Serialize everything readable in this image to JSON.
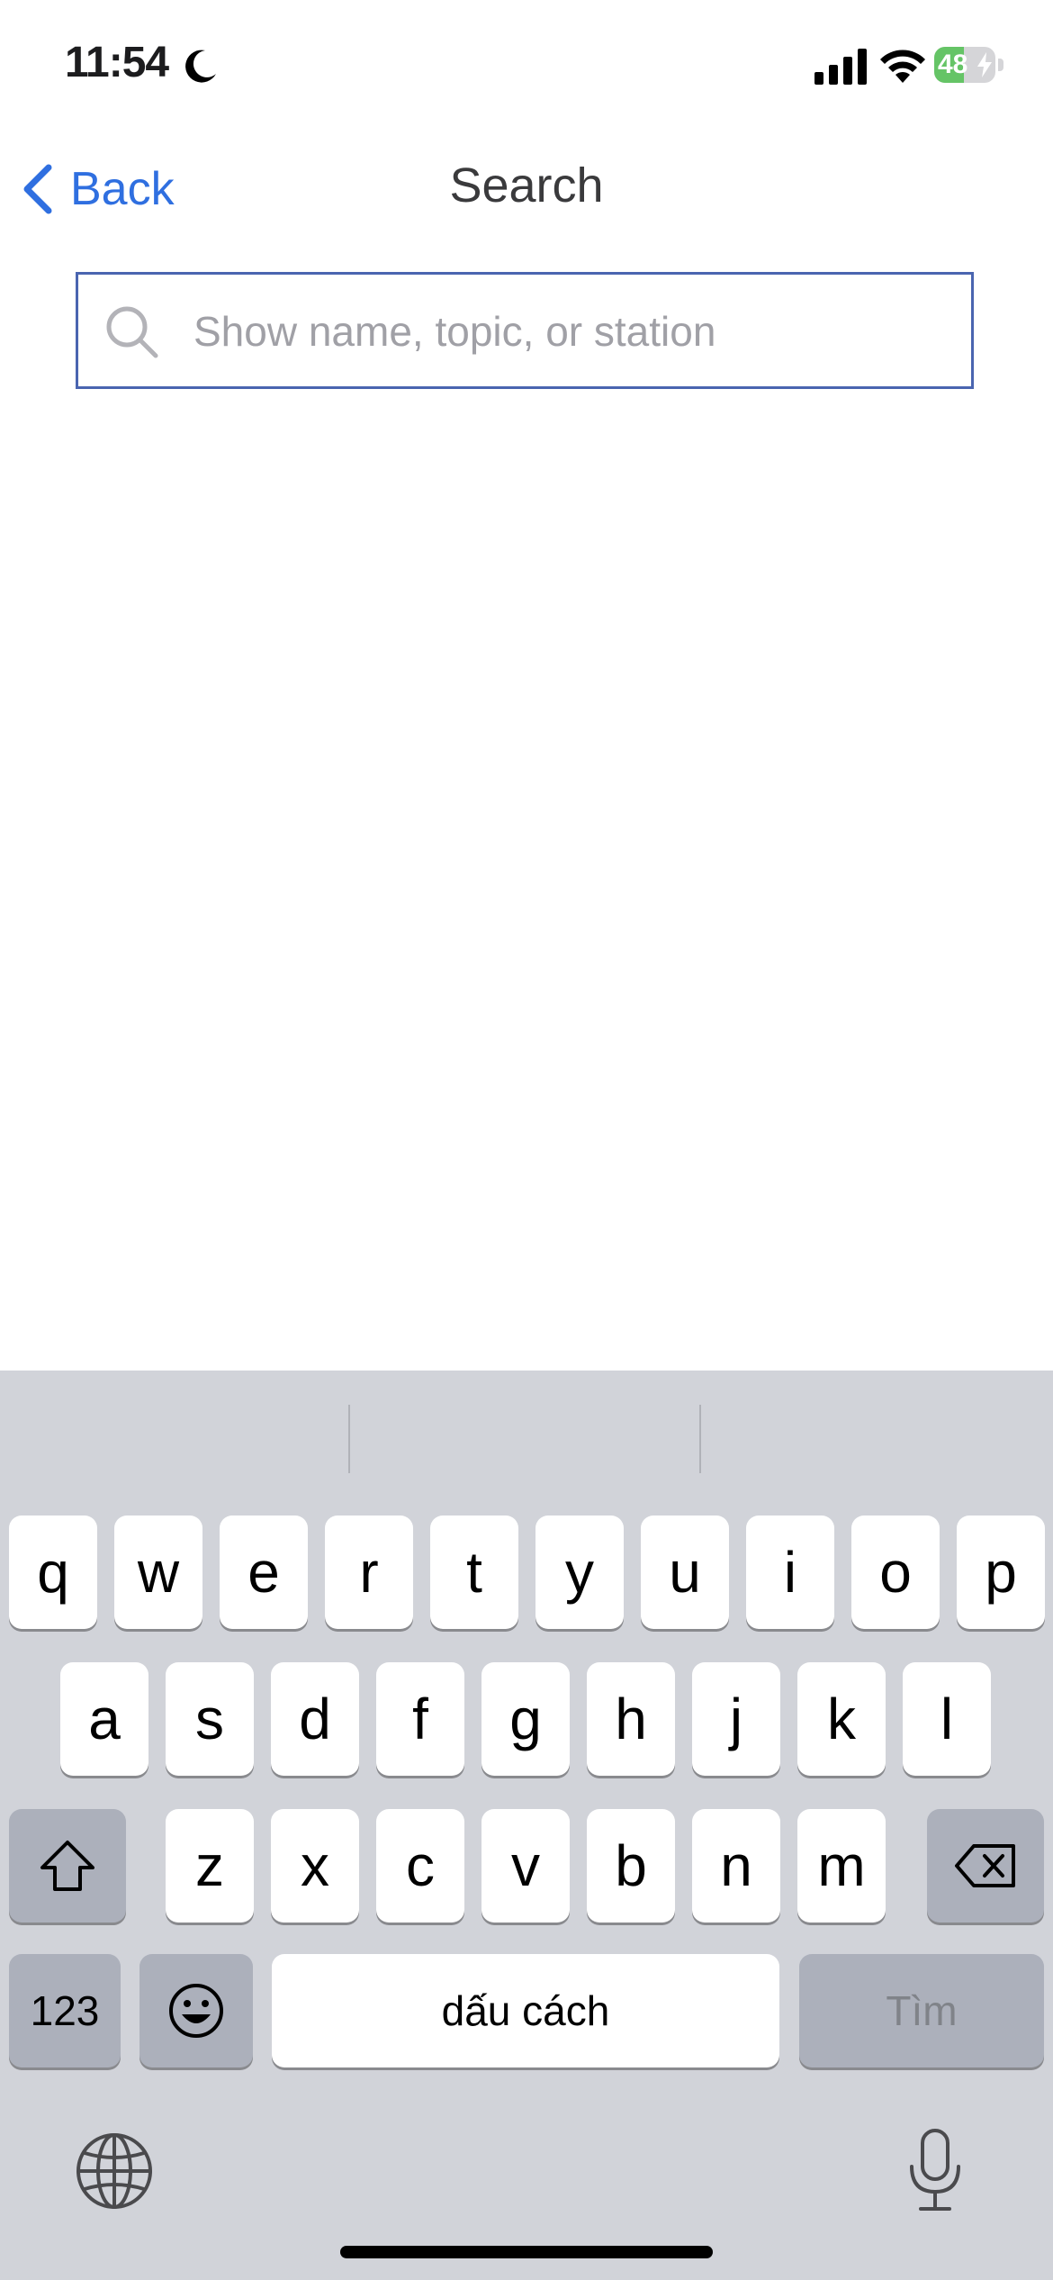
{
  "status_bar": {
    "time": "11:54",
    "battery_level": "48",
    "battery_fraction": 0.48
  },
  "nav": {
    "back_label": "Back",
    "title": "Search"
  },
  "search": {
    "placeholder": "Show name, topic, or station",
    "value": ""
  },
  "keyboard": {
    "row1": [
      "q",
      "w",
      "e",
      "r",
      "t",
      "y",
      "u",
      "i",
      "o",
      "p"
    ],
    "row2": [
      "a",
      "s",
      "d",
      "f",
      "g",
      "h",
      "j",
      "k",
      "l"
    ],
    "row3": [
      "z",
      "x",
      "c",
      "v",
      "b",
      "n",
      "m"
    ],
    "numbers_label": "123",
    "space_label": "dấu cách",
    "return_label": "Tìm",
    "icons": [
      "shift-icon",
      "backspace-icon",
      "emoji-icon",
      "globe-icon",
      "microphone-icon"
    ]
  },
  "colors": {
    "accent": "#2f6fe0",
    "search_border": "#4a65b0",
    "keyboard_bg": "#d1d3d9",
    "battery": "#65c466"
  }
}
